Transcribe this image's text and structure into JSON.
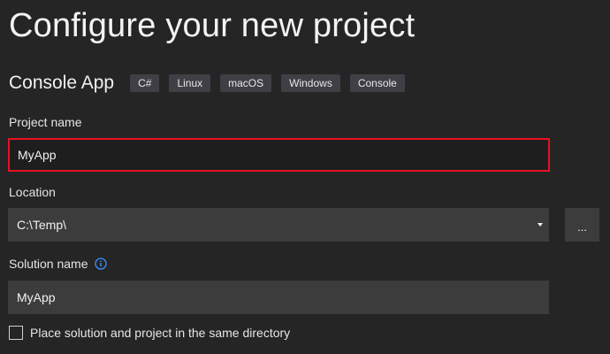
{
  "page": {
    "title": "Configure your new project"
  },
  "template": {
    "name": "Console App",
    "tags": [
      "C#",
      "Linux",
      "macOS",
      "Windows",
      "Console"
    ]
  },
  "project_name": {
    "label": "Project name",
    "value": "MyApp"
  },
  "location": {
    "label": "Location",
    "value": "C:\\Temp\\",
    "browse_label": "..."
  },
  "solution_name": {
    "label": "Solution name",
    "value": "MyApp",
    "info_icon": "info-icon"
  },
  "same_directory": {
    "label": "Place solution and project in the same directory",
    "checked": false
  },
  "colors": {
    "background": "#252526",
    "input_background": "#3c3c3c",
    "focus_border": "#e81123",
    "tag_background": "#3f3f46",
    "info_accent": "#3794ff"
  }
}
